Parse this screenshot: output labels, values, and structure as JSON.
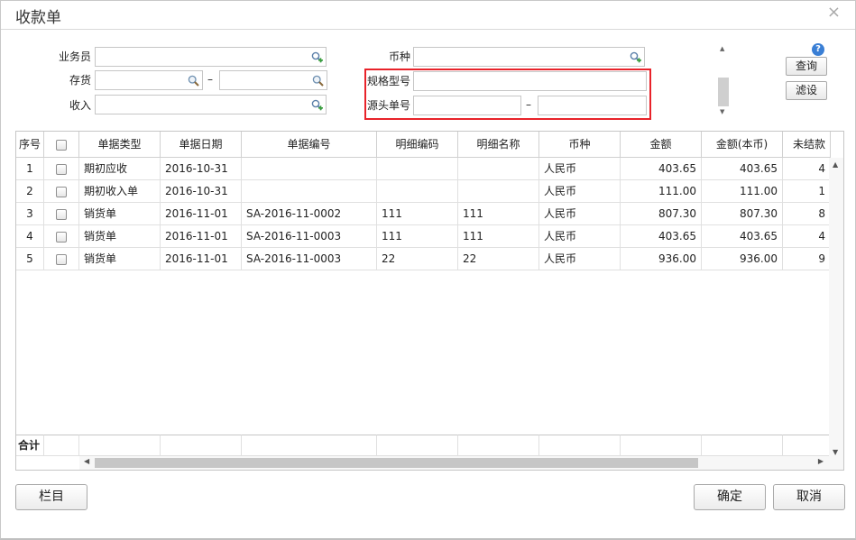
{
  "dialog": {
    "title": "收款单",
    "close_glyph": "×"
  },
  "filters": {
    "salesman_label": "业务员",
    "inventory_label": "存货",
    "income_label": "收入",
    "currency_label": "币种",
    "spec_label": "规格型号",
    "source_no_label": "源头单号",
    "range_dash": "–",
    "values": {
      "salesman": "",
      "inventory_from": "",
      "inventory_to": "",
      "income": "",
      "currency": "",
      "spec": "",
      "source_from": "",
      "source_to": ""
    }
  },
  "side_buttons": {
    "help": "?",
    "query": "查询",
    "filter": "滤设"
  },
  "table": {
    "columns": [
      "序号",
      "",
      "单据类型",
      "单据日期",
      "单据编号",
      "明细编码",
      "明细名称",
      "币种",
      "金额",
      "金额(本币)",
      "未结款"
    ],
    "rows": [
      {
        "seq": "1",
        "type": "期初应收",
        "date": "2016-10-31",
        "no": "",
        "code": "",
        "name": "",
        "currency": "人民币",
        "amount": "403.65",
        "amount_local": "403.65",
        "unpaid": "4"
      },
      {
        "seq": "2",
        "type": "期初收入单",
        "date": "2016-10-31",
        "no": "",
        "code": "",
        "name": "",
        "currency": "人民币",
        "amount": "111.00",
        "amount_local": "111.00",
        "unpaid": "1"
      },
      {
        "seq": "3",
        "type": "销货单",
        "date": "2016-11-01",
        "no": "SA-2016-11-0002",
        "code": "111",
        "name": "111",
        "currency": "人民币",
        "amount": "807.30",
        "amount_local": "807.30",
        "unpaid": "8"
      },
      {
        "seq": "4",
        "type": "销货单",
        "date": "2016-11-01",
        "no": "SA-2016-11-0003",
        "code": "111",
        "name": "111",
        "currency": "人民币",
        "amount": "403.65",
        "amount_local": "403.65",
        "unpaid": "4"
      },
      {
        "seq": "5",
        "type": "销货单",
        "date": "2016-11-01",
        "no": "SA-2016-11-0003",
        "code": "22",
        "name": "22",
        "currency": "人民币",
        "amount": "936.00",
        "amount_local": "936.00",
        "unpaid": "9"
      }
    ],
    "total_label": "合计"
  },
  "footer": {
    "columns_button": "栏目",
    "ok_button": "确定",
    "cancel_button": "取消"
  },
  "colors": {
    "highlight": "#e8232a",
    "help_icon": "#3a7fd5"
  }
}
